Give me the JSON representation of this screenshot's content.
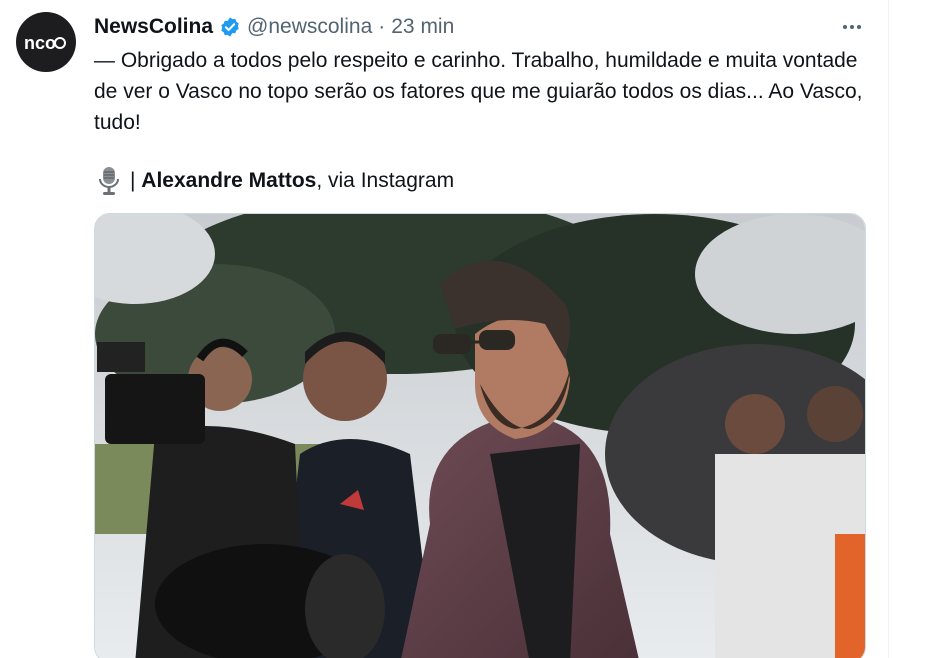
{
  "tweet": {
    "author": {
      "display_name": "NewsColina",
      "handle": "@newscolina",
      "avatar_text": "nco",
      "verified": true
    },
    "separator": "·",
    "time": "23 min",
    "text": "— Obrigado a todos pelo respeito e carinho. Trabalho, humildade e muita vontade de ver o Vasco no topo serão os fatores que me guiarão todos os dias... Ao Vasco, tudo!",
    "credit": {
      "icon": "microphone-icon",
      "prefix": "| ",
      "name": "Alexandre Mattos",
      "suffix": ", via Instagram"
    },
    "more_icon": "more-options-icon",
    "media_icon": "photo"
  },
  "colors": {
    "text_primary": "#0f1419",
    "text_secondary": "#536471",
    "verified_blue": "#1d9bf0",
    "border": "#cfd9de"
  }
}
